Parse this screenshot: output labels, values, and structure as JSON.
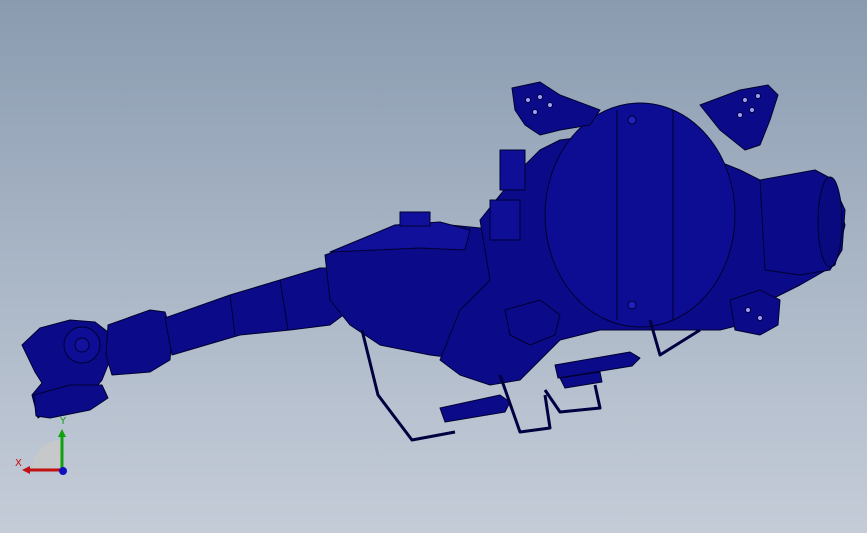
{
  "viewport": {
    "background_top": "#8a9bb0",
    "background_bottom": "#c5ccd8"
  },
  "model": {
    "color": "#0b0b8a",
    "edge_color": "#000030",
    "highlight_color": "#1a1ab0"
  },
  "triad": {
    "x_label": "X",
    "y_label": "Y",
    "x_color": "#c01010",
    "y_color": "#10a010",
    "z_color": "#1010c0"
  }
}
